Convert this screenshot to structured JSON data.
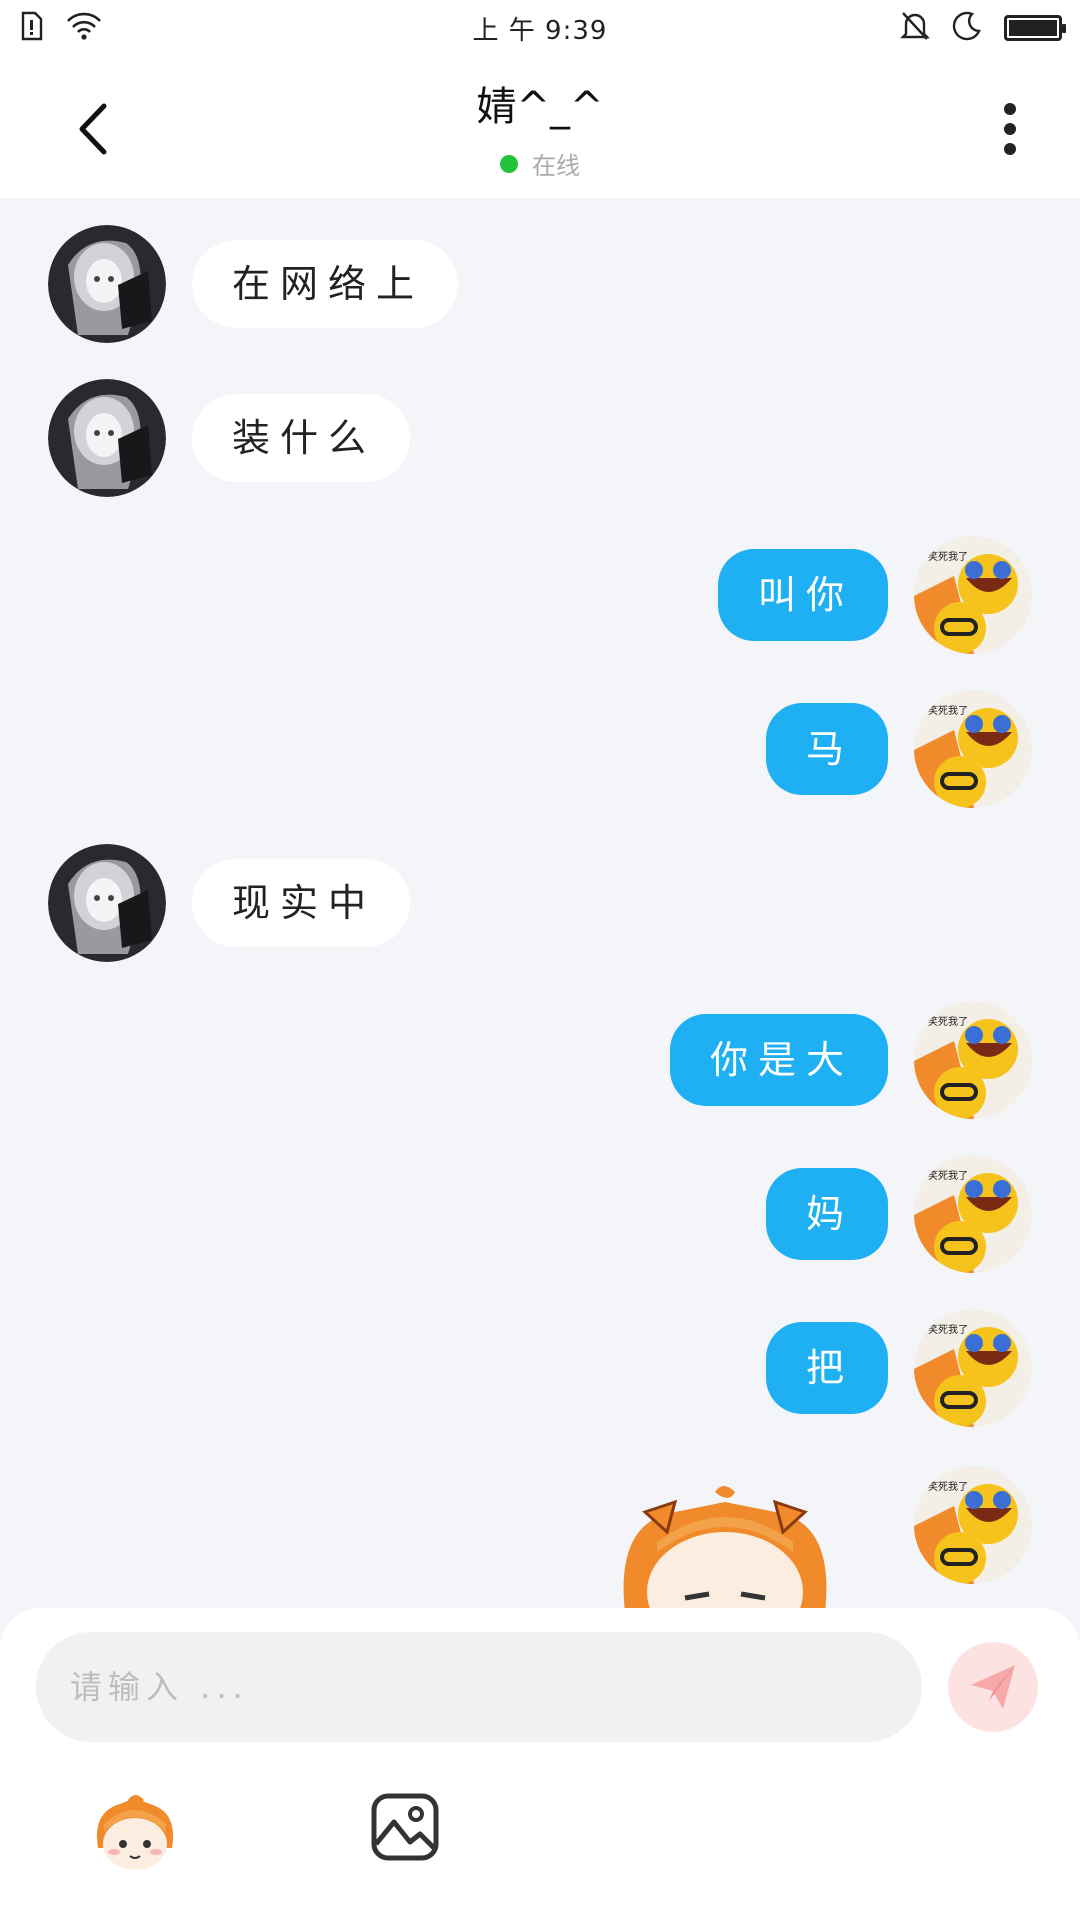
{
  "status_bar": {
    "time": "上 午 9:39",
    "icons": [
      "sim-alert-icon",
      "wifi-icon",
      "mute-bell-icon",
      "moon-icon",
      "battery-icon"
    ]
  },
  "header": {
    "title": "婧^_^",
    "status": "在线",
    "status_color": "#21c33b",
    "back_icon": "chevron-left-icon",
    "more_icon": "more-vertical-icon"
  },
  "messages": [
    {
      "side": "left",
      "text": "在网络上"
    },
    {
      "side": "left",
      "text": "装什么"
    },
    {
      "side": "right",
      "text": "叫你"
    },
    {
      "side": "right",
      "text": "马"
    },
    {
      "side": "left",
      "text": "现实中"
    },
    {
      "side": "right",
      "text": "你是大"
    },
    {
      "side": "right",
      "text": "妈"
    },
    {
      "side": "right",
      "text": "把"
    },
    {
      "side": "right",
      "text": "",
      "sticker": "anime-girl-sticker"
    }
  ],
  "composer": {
    "placeholder": "请输入 ...",
    "send_icon": "paper-plane-icon",
    "tools": [
      "emoji-icon",
      "image-icon"
    ]
  },
  "colors": {
    "accent_blue": "#1fb0f3",
    "background": "#f3f5f9"
  }
}
